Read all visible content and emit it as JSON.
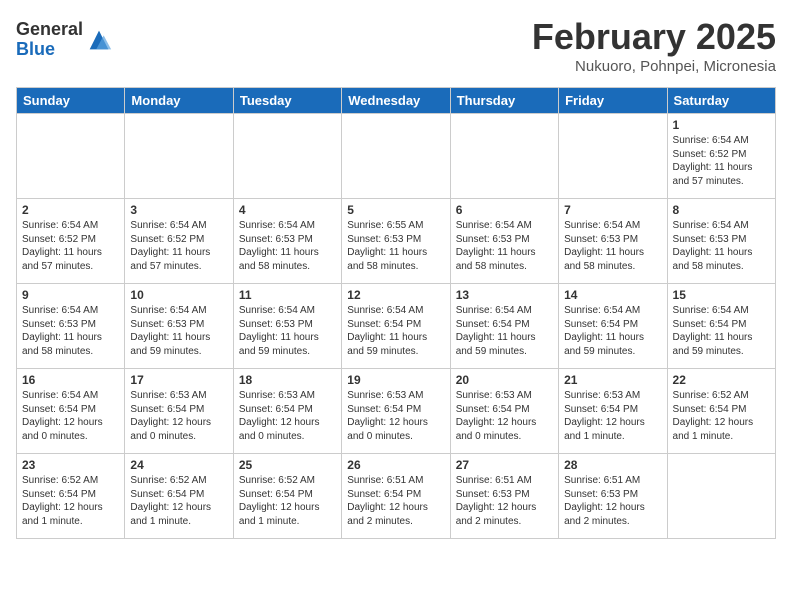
{
  "logo": {
    "general": "General",
    "blue": "Blue"
  },
  "title": "February 2025",
  "subtitle": "Nukuoro, Pohnpei, Micronesia",
  "headers": [
    "Sunday",
    "Monday",
    "Tuesday",
    "Wednesday",
    "Thursday",
    "Friday",
    "Saturday"
  ],
  "weeks": [
    [
      {
        "day": "",
        "info": ""
      },
      {
        "day": "",
        "info": ""
      },
      {
        "day": "",
        "info": ""
      },
      {
        "day": "",
        "info": ""
      },
      {
        "day": "",
        "info": ""
      },
      {
        "day": "",
        "info": ""
      },
      {
        "day": "1",
        "info": "Sunrise: 6:54 AM\nSunset: 6:52 PM\nDaylight: 11 hours\nand 57 minutes."
      }
    ],
    [
      {
        "day": "2",
        "info": "Sunrise: 6:54 AM\nSunset: 6:52 PM\nDaylight: 11 hours\nand 57 minutes."
      },
      {
        "day": "3",
        "info": "Sunrise: 6:54 AM\nSunset: 6:52 PM\nDaylight: 11 hours\nand 57 minutes."
      },
      {
        "day": "4",
        "info": "Sunrise: 6:54 AM\nSunset: 6:53 PM\nDaylight: 11 hours\nand 58 minutes."
      },
      {
        "day": "5",
        "info": "Sunrise: 6:55 AM\nSunset: 6:53 PM\nDaylight: 11 hours\nand 58 minutes."
      },
      {
        "day": "6",
        "info": "Sunrise: 6:54 AM\nSunset: 6:53 PM\nDaylight: 11 hours\nand 58 minutes."
      },
      {
        "day": "7",
        "info": "Sunrise: 6:54 AM\nSunset: 6:53 PM\nDaylight: 11 hours\nand 58 minutes."
      },
      {
        "day": "8",
        "info": "Sunrise: 6:54 AM\nSunset: 6:53 PM\nDaylight: 11 hours\nand 58 minutes."
      }
    ],
    [
      {
        "day": "9",
        "info": "Sunrise: 6:54 AM\nSunset: 6:53 PM\nDaylight: 11 hours\nand 58 minutes."
      },
      {
        "day": "10",
        "info": "Sunrise: 6:54 AM\nSunset: 6:53 PM\nDaylight: 11 hours\nand 59 minutes."
      },
      {
        "day": "11",
        "info": "Sunrise: 6:54 AM\nSunset: 6:53 PM\nDaylight: 11 hours\nand 59 minutes."
      },
      {
        "day": "12",
        "info": "Sunrise: 6:54 AM\nSunset: 6:54 PM\nDaylight: 11 hours\nand 59 minutes."
      },
      {
        "day": "13",
        "info": "Sunrise: 6:54 AM\nSunset: 6:54 PM\nDaylight: 11 hours\nand 59 minutes."
      },
      {
        "day": "14",
        "info": "Sunrise: 6:54 AM\nSunset: 6:54 PM\nDaylight: 11 hours\nand 59 minutes."
      },
      {
        "day": "15",
        "info": "Sunrise: 6:54 AM\nSunset: 6:54 PM\nDaylight: 11 hours\nand 59 minutes."
      }
    ],
    [
      {
        "day": "16",
        "info": "Sunrise: 6:54 AM\nSunset: 6:54 PM\nDaylight: 12 hours\nand 0 minutes."
      },
      {
        "day": "17",
        "info": "Sunrise: 6:53 AM\nSunset: 6:54 PM\nDaylight: 12 hours\nand 0 minutes."
      },
      {
        "day": "18",
        "info": "Sunrise: 6:53 AM\nSunset: 6:54 PM\nDaylight: 12 hours\nand 0 minutes."
      },
      {
        "day": "19",
        "info": "Sunrise: 6:53 AM\nSunset: 6:54 PM\nDaylight: 12 hours\nand 0 minutes."
      },
      {
        "day": "20",
        "info": "Sunrise: 6:53 AM\nSunset: 6:54 PM\nDaylight: 12 hours\nand 0 minutes."
      },
      {
        "day": "21",
        "info": "Sunrise: 6:53 AM\nSunset: 6:54 PM\nDaylight: 12 hours\nand 1 minute."
      },
      {
        "day": "22",
        "info": "Sunrise: 6:52 AM\nSunset: 6:54 PM\nDaylight: 12 hours\nand 1 minute."
      }
    ],
    [
      {
        "day": "23",
        "info": "Sunrise: 6:52 AM\nSunset: 6:54 PM\nDaylight: 12 hours\nand 1 minute."
      },
      {
        "day": "24",
        "info": "Sunrise: 6:52 AM\nSunset: 6:54 PM\nDaylight: 12 hours\nand 1 minute."
      },
      {
        "day": "25",
        "info": "Sunrise: 6:52 AM\nSunset: 6:54 PM\nDaylight: 12 hours\nand 1 minute."
      },
      {
        "day": "26",
        "info": "Sunrise: 6:51 AM\nSunset: 6:54 PM\nDaylight: 12 hours\nand 2 minutes."
      },
      {
        "day": "27",
        "info": "Sunrise: 6:51 AM\nSunset: 6:53 PM\nDaylight: 12 hours\nand 2 minutes."
      },
      {
        "day": "28",
        "info": "Sunrise: 6:51 AM\nSunset: 6:53 PM\nDaylight: 12 hours\nand 2 minutes."
      },
      {
        "day": "",
        "info": ""
      }
    ]
  ]
}
